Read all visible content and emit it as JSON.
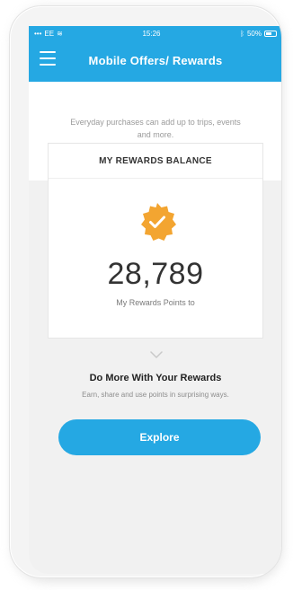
{
  "status_bar": {
    "carrier": "EE",
    "time": "15:26",
    "battery": "50%"
  },
  "app_bar": {
    "title": "Mobile Offers/ Rewards",
    "menu_icon": "hamburger-icon"
  },
  "intro": {
    "text": "Everyday purchases can add up to trips, events and more."
  },
  "rewards_card": {
    "header": "MY REWARDS BALANCE",
    "badge_icon": "verified-check-badge-icon",
    "points": "28,789",
    "points_label": "My Rewards Points to"
  },
  "more_section": {
    "title": "Do More With Your Rewards",
    "subtitle": "Earn, share and use points in surprising ways.",
    "button_label": "Explore"
  },
  "colors": {
    "brand_blue": "#25a8e3",
    "badge_orange": "#f3a531"
  }
}
